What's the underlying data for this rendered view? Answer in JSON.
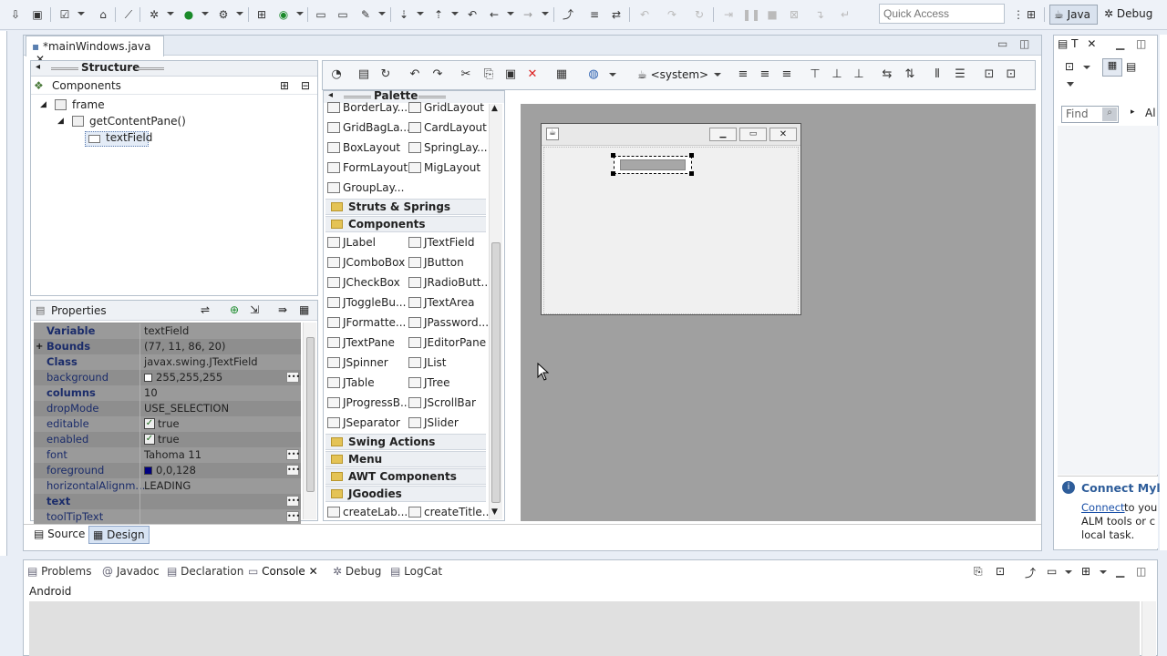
{
  "toolbar": {
    "quick_access_placeholder": "Quick Access",
    "perspective_java": "Java",
    "perspective_debug": "Debug"
  },
  "editor": {
    "tab_label": "*mainWindows.java",
    "source_tab": "Source",
    "design_tab": "Design"
  },
  "structure": {
    "title": "Structure",
    "components_label": "Components",
    "tree": [
      "frame",
      "getContentPane()",
      "textField"
    ]
  },
  "properties": {
    "title": "Properties",
    "rows": [
      {
        "name": "Variable",
        "value": "textField",
        "bold": true
      },
      {
        "name": "Bounds",
        "value": "(77, 11, 86, 20)",
        "bold": true,
        "expand": "+"
      },
      {
        "name": "Class",
        "value": "javax.swing.JTextField",
        "bold": true
      },
      {
        "name": "background",
        "value": "255,255,255",
        "swatch": "#ffffff",
        "btn": true
      },
      {
        "name": "columns",
        "value": "10",
        "bold": true
      },
      {
        "name": "dropMode",
        "value": "USE_SELECTION"
      },
      {
        "name": "editable",
        "value": "true",
        "check": true
      },
      {
        "name": "enabled",
        "value": "true",
        "check": true
      },
      {
        "name": "font",
        "value": "Tahoma 11",
        "btn": true
      },
      {
        "name": "foreground",
        "value": "0,0,128",
        "swatch": "#000080",
        "btn": true
      },
      {
        "name": "horizontalAlignm...",
        "value": "LEADING"
      },
      {
        "name": "text",
        "value": "",
        "bold": true,
        "btn": true
      },
      {
        "name": "toolTipText",
        "value": "",
        "btn": true
      }
    ]
  },
  "palette": {
    "title": "Palette",
    "layouts": [
      [
        "BorderLay...",
        "GridLayout"
      ],
      [
        "GridBagLa...",
        "CardLayout"
      ],
      [
        "BoxLayout",
        "SpringLay..."
      ],
      [
        "FormLayout",
        "MigLayout"
      ],
      [
        "GroupLay...",
        ""
      ]
    ],
    "folder_struts": "Struts & Springs",
    "folder_components": "Components",
    "components": [
      [
        "JLabel",
        "JTextField"
      ],
      [
        "JComboBox",
        "JButton"
      ],
      [
        "JCheckBox",
        "JRadioButt..."
      ],
      [
        "JToggleBu...",
        "JTextArea"
      ],
      [
        "JFormatte...",
        "JPassword..."
      ],
      [
        "JTextPane",
        "JEditorPane"
      ],
      [
        "JSpinner",
        "JList"
      ],
      [
        "JTable",
        "JTree"
      ],
      [
        "JProgressB...",
        "JScrollBar"
      ],
      [
        "JSeparator",
        "JSlider"
      ]
    ],
    "folder_swing_actions": "Swing Actions",
    "folder_menu": "Menu",
    "folder_awt": "AWT Components",
    "folder_jgoodies": "JGoodies",
    "bottom": [
      "createLab...",
      "createTitle..."
    ]
  },
  "design_toolbar": {
    "look_and_feel": "<system>"
  },
  "right_panel": {
    "tab_label": "T",
    "find_placeholder": "Find",
    "all_label": "Al",
    "connect_title": "Connect Myl",
    "connect_link": "Connect",
    "connect_text": [
      " to you",
      "ALM tools or c",
      "local task."
    ]
  },
  "console": {
    "tabs": [
      "Problems",
      "Javadoc",
      "Declaration",
      "Console",
      "Debug",
      "LogCat"
    ],
    "content_label": "Android"
  }
}
